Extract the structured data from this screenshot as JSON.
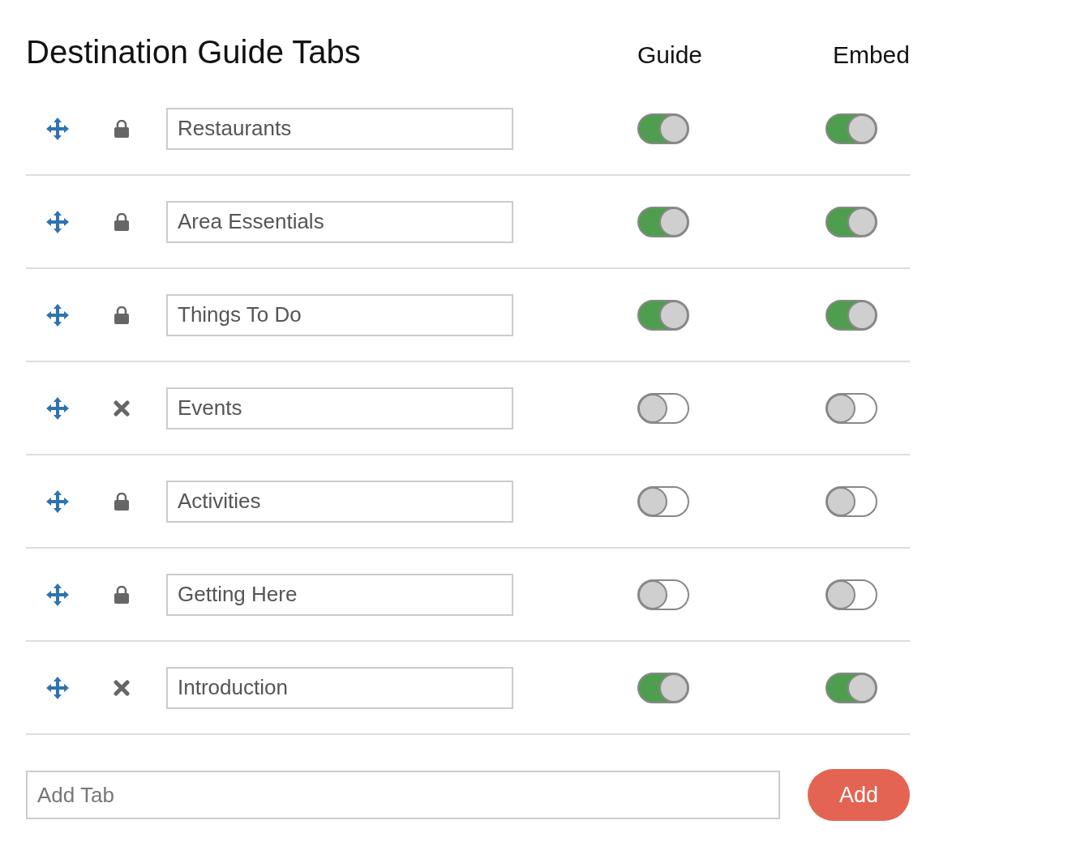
{
  "title": "Destination Guide Tabs",
  "columns": {
    "guide": "Guide",
    "embed": "Embed"
  },
  "tabs": [
    {
      "name": "Restaurants",
      "kind": "locked",
      "guide": true,
      "embed": true
    },
    {
      "name": "Area Essentials",
      "kind": "locked",
      "guide": true,
      "embed": true
    },
    {
      "name": "Things To Do",
      "kind": "locked",
      "guide": true,
      "embed": true
    },
    {
      "name": "Events",
      "kind": "removable",
      "guide": false,
      "embed": false
    },
    {
      "name": "Activities",
      "kind": "locked",
      "guide": false,
      "embed": false
    },
    {
      "name": "Getting Here",
      "kind": "locked",
      "guide": false,
      "embed": false
    },
    {
      "name": "Introduction",
      "kind": "removable",
      "guide": true,
      "embed": true
    }
  ],
  "add": {
    "placeholder": "Add Tab",
    "button": "Add"
  }
}
